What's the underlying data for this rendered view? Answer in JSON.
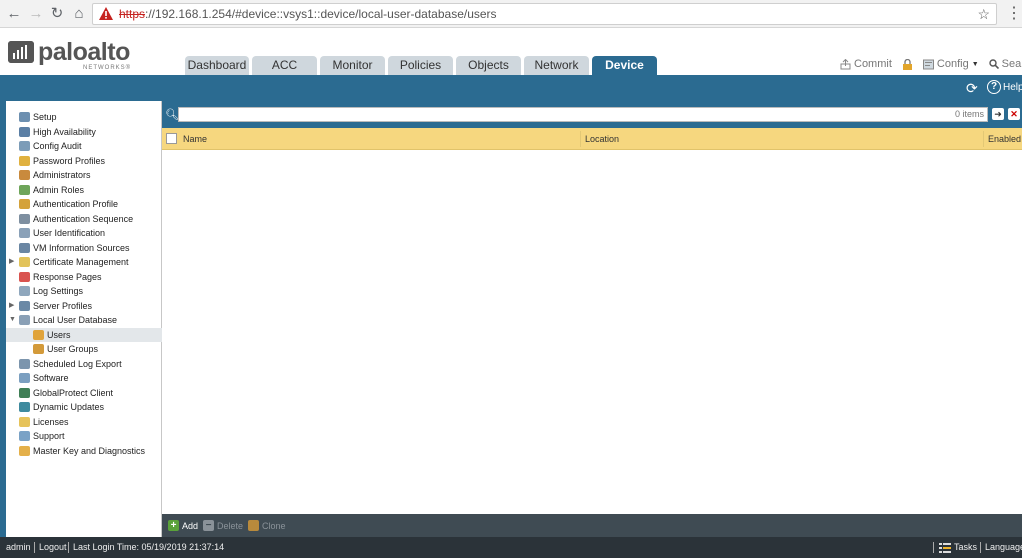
{
  "browser": {
    "url_scheme": "https",
    "url_rest": "://192.168.1.254/#device::vsys1::device/local-user-database/users",
    "back_glyph": "←",
    "forward_glyph": "→",
    "reload_glyph": "↻",
    "home_glyph": "⌂"
  },
  "logo": {
    "name": "paloalto",
    "sub": "NETWORKS®"
  },
  "tabs": [
    {
      "label": "Dashboard",
      "active": false
    },
    {
      "label": "ACC",
      "active": false
    },
    {
      "label": "Monitor",
      "active": false
    },
    {
      "label": "Policies",
      "active": false
    },
    {
      "label": "Objects",
      "active": false
    },
    {
      "label": "Network",
      "active": false
    },
    {
      "label": "Device",
      "active": true
    }
  ],
  "header_actions": {
    "commit": "Commit",
    "config": "Config",
    "search": "Search"
  },
  "help_label": "Help",
  "sidebar": {
    "items": [
      {
        "label": "Setup",
        "icon": "setup-icon",
        "level": 0
      },
      {
        "label": "High Availability",
        "icon": "ha-icon",
        "level": 0
      },
      {
        "label": "Config Audit",
        "icon": "audit-icon",
        "level": 0
      },
      {
        "label": "Password Profiles",
        "icon": "password-icon",
        "level": 0
      },
      {
        "label": "Administrators",
        "icon": "admin-icon",
        "level": 0
      },
      {
        "label": "Admin Roles",
        "icon": "roles-icon",
        "level": 0
      },
      {
        "label": "Authentication Profile",
        "icon": "auth-profile-icon",
        "level": 0
      },
      {
        "label": "Authentication Sequence",
        "icon": "auth-sequence-icon",
        "level": 0
      },
      {
        "label": "User Identification",
        "icon": "user-id-icon",
        "level": 0
      },
      {
        "label": "VM Information Sources",
        "icon": "vm-icon",
        "level": 0
      },
      {
        "label": "Certificate Management",
        "icon": "cert-icon",
        "level": 0,
        "expander": "▶"
      },
      {
        "label": "Response Pages",
        "icon": "response-icon",
        "level": 0
      },
      {
        "label": "Log Settings",
        "icon": "log-icon",
        "level": 0
      },
      {
        "label": "Server Profiles",
        "icon": "server-icon",
        "level": 0,
        "expander": "▶"
      },
      {
        "label": "Local User Database",
        "icon": "local-db-icon",
        "level": 0,
        "expander": "▼"
      },
      {
        "label": "Users",
        "icon": "users-icon",
        "level": 1,
        "selected": true
      },
      {
        "label": "User Groups",
        "icon": "user-groups-icon",
        "level": 1
      },
      {
        "label": "Scheduled Log Export",
        "icon": "export-icon",
        "level": 0
      },
      {
        "label": "Software",
        "icon": "software-icon",
        "level": 0
      },
      {
        "label": "GlobalProtect Client",
        "icon": "globalprotect-icon",
        "level": 0
      },
      {
        "label": "Dynamic Updates",
        "icon": "updates-icon",
        "level": 0
      },
      {
        "label": "Licenses",
        "icon": "license-icon",
        "level": 0
      },
      {
        "label": "Support",
        "icon": "support-icon",
        "level": 0
      },
      {
        "label": "Master Key and Diagnostics",
        "icon": "master-key-icon",
        "level": 0
      }
    ]
  },
  "filter": {
    "count_text": "0 items"
  },
  "table": {
    "columns": [
      "Name",
      "Location",
      "Enabled"
    ]
  },
  "bottom_actions": {
    "add": "Add",
    "delete": "Delete",
    "clone": "Clone"
  },
  "status_bar": {
    "user": "admin",
    "logout": "Logout",
    "last_login": "Last Login Time: 05/19/2019 21:37:14",
    "tasks": "Tasks",
    "language": "Language"
  },
  "colors": {
    "brand": "#2b6b91",
    "header_row": "#f6d77f",
    "status_bar": "#2b3339"
  }
}
